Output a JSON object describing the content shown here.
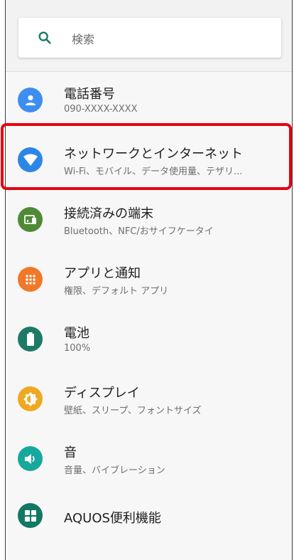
{
  "search": {
    "placeholder": "検索"
  },
  "items": [
    {
      "title": "電話番号",
      "subtitle": "090-XXXX-XXXX",
      "color": "#3d8ef0"
    },
    {
      "title": "ネットワークとインターネット",
      "subtitle": "Wi-Fi、モバイル、データ使用量、テザリ...",
      "color": "#2c86e6"
    },
    {
      "title": "接続済みの端末",
      "subtitle": "Bluetooth、NFC/おサイフケータイ",
      "color": "#4f8a36"
    },
    {
      "title": "アプリと通知",
      "subtitle": "権限、デフォルト アプリ",
      "color": "#f07828"
    },
    {
      "title": "電池",
      "subtitle": "100%",
      "color": "#1e7a66"
    },
    {
      "title": "ディスプレイ",
      "subtitle": "壁紙、スリープ、フォントサイズ",
      "color": "#f0a820"
    },
    {
      "title": "音",
      "subtitle": "音量、バイブレーション",
      "color": "#17a89c"
    },
    {
      "title": "AQUOS便利機能",
      "subtitle": "",
      "color": "#127864"
    }
  ],
  "highlight_color": "#e60012"
}
